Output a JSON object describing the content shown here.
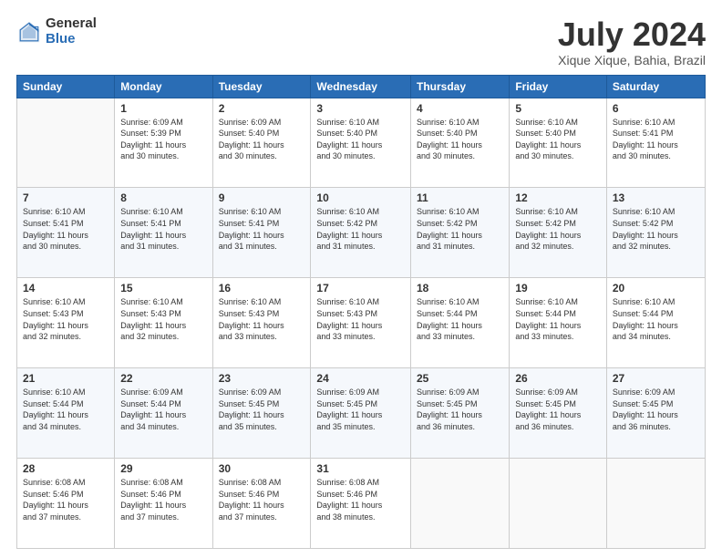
{
  "logo": {
    "general": "General",
    "blue": "Blue"
  },
  "title": "July 2024",
  "subtitle": "Xique Xique, Bahia, Brazil",
  "days_header": [
    "Sunday",
    "Monday",
    "Tuesday",
    "Wednesday",
    "Thursday",
    "Friday",
    "Saturday"
  ],
  "weeks": [
    [
      {
        "day": "",
        "info": ""
      },
      {
        "day": "1",
        "info": "Sunrise: 6:09 AM\nSunset: 5:39 PM\nDaylight: 11 hours\nand 30 minutes."
      },
      {
        "day": "2",
        "info": "Sunrise: 6:09 AM\nSunset: 5:40 PM\nDaylight: 11 hours\nand 30 minutes."
      },
      {
        "day": "3",
        "info": "Sunrise: 6:10 AM\nSunset: 5:40 PM\nDaylight: 11 hours\nand 30 minutes."
      },
      {
        "day": "4",
        "info": "Sunrise: 6:10 AM\nSunset: 5:40 PM\nDaylight: 11 hours\nand 30 minutes."
      },
      {
        "day": "5",
        "info": "Sunrise: 6:10 AM\nSunset: 5:40 PM\nDaylight: 11 hours\nand 30 minutes."
      },
      {
        "day": "6",
        "info": "Sunrise: 6:10 AM\nSunset: 5:41 PM\nDaylight: 11 hours\nand 30 minutes."
      }
    ],
    [
      {
        "day": "7",
        "info": "Sunrise: 6:10 AM\nSunset: 5:41 PM\nDaylight: 11 hours\nand 30 minutes."
      },
      {
        "day": "8",
        "info": "Sunrise: 6:10 AM\nSunset: 5:41 PM\nDaylight: 11 hours\nand 31 minutes."
      },
      {
        "day": "9",
        "info": "Sunrise: 6:10 AM\nSunset: 5:41 PM\nDaylight: 11 hours\nand 31 minutes."
      },
      {
        "day": "10",
        "info": "Sunrise: 6:10 AM\nSunset: 5:42 PM\nDaylight: 11 hours\nand 31 minutes."
      },
      {
        "day": "11",
        "info": "Sunrise: 6:10 AM\nSunset: 5:42 PM\nDaylight: 11 hours\nand 31 minutes."
      },
      {
        "day": "12",
        "info": "Sunrise: 6:10 AM\nSunset: 5:42 PM\nDaylight: 11 hours\nand 32 minutes."
      },
      {
        "day": "13",
        "info": "Sunrise: 6:10 AM\nSunset: 5:42 PM\nDaylight: 11 hours\nand 32 minutes."
      }
    ],
    [
      {
        "day": "14",
        "info": "Sunrise: 6:10 AM\nSunset: 5:43 PM\nDaylight: 11 hours\nand 32 minutes."
      },
      {
        "day": "15",
        "info": "Sunrise: 6:10 AM\nSunset: 5:43 PM\nDaylight: 11 hours\nand 32 minutes."
      },
      {
        "day": "16",
        "info": "Sunrise: 6:10 AM\nSunset: 5:43 PM\nDaylight: 11 hours\nand 33 minutes."
      },
      {
        "day": "17",
        "info": "Sunrise: 6:10 AM\nSunset: 5:43 PM\nDaylight: 11 hours\nand 33 minutes."
      },
      {
        "day": "18",
        "info": "Sunrise: 6:10 AM\nSunset: 5:44 PM\nDaylight: 11 hours\nand 33 minutes."
      },
      {
        "day": "19",
        "info": "Sunrise: 6:10 AM\nSunset: 5:44 PM\nDaylight: 11 hours\nand 33 minutes."
      },
      {
        "day": "20",
        "info": "Sunrise: 6:10 AM\nSunset: 5:44 PM\nDaylight: 11 hours\nand 34 minutes."
      }
    ],
    [
      {
        "day": "21",
        "info": "Sunrise: 6:10 AM\nSunset: 5:44 PM\nDaylight: 11 hours\nand 34 minutes."
      },
      {
        "day": "22",
        "info": "Sunrise: 6:09 AM\nSunset: 5:44 PM\nDaylight: 11 hours\nand 34 minutes."
      },
      {
        "day": "23",
        "info": "Sunrise: 6:09 AM\nSunset: 5:45 PM\nDaylight: 11 hours\nand 35 minutes."
      },
      {
        "day": "24",
        "info": "Sunrise: 6:09 AM\nSunset: 5:45 PM\nDaylight: 11 hours\nand 35 minutes."
      },
      {
        "day": "25",
        "info": "Sunrise: 6:09 AM\nSunset: 5:45 PM\nDaylight: 11 hours\nand 36 minutes."
      },
      {
        "day": "26",
        "info": "Sunrise: 6:09 AM\nSunset: 5:45 PM\nDaylight: 11 hours\nand 36 minutes."
      },
      {
        "day": "27",
        "info": "Sunrise: 6:09 AM\nSunset: 5:45 PM\nDaylight: 11 hours\nand 36 minutes."
      }
    ],
    [
      {
        "day": "28",
        "info": "Sunrise: 6:08 AM\nSunset: 5:46 PM\nDaylight: 11 hours\nand 37 minutes."
      },
      {
        "day": "29",
        "info": "Sunrise: 6:08 AM\nSunset: 5:46 PM\nDaylight: 11 hours\nand 37 minutes."
      },
      {
        "day": "30",
        "info": "Sunrise: 6:08 AM\nSunset: 5:46 PM\nDaylight: 11 hours\nand 37 minutes."
      },
      {
        "day": "31",
        "info": "Sunrise: 6:08 AM\nSunset: 5:46 PM\nDaylight: 11 hours\nand 38 minutes."
      },
      {
        "day": "",
        "info": ""
      },
      {
        "day": "",
        "info": ""
      },
      {
        "day": "",
        "info": ""
      }
    ]
  ]
}
